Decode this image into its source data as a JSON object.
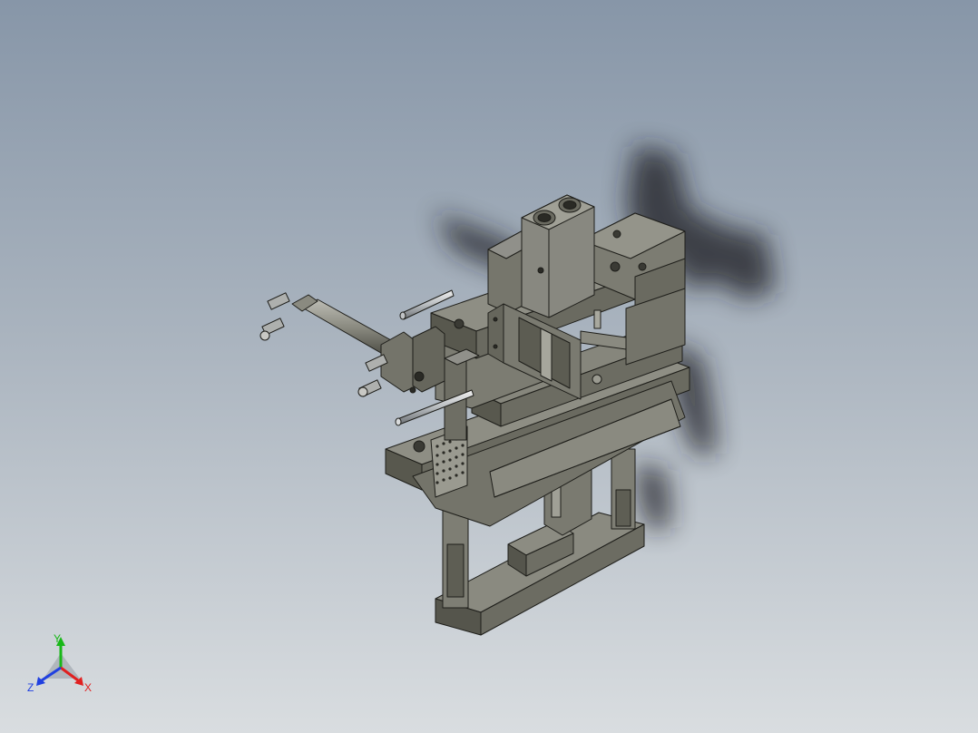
{
  "viewport": {
    "background_top": "#8796a8",
    "background_bottom": "#d9dde0"
  },
  "model": {
    "body_color": "#6f6f64",
    "edge_color": "#1e1e1a",
    "shadow_color": "#1c1f24",
    "rod_color": "#c9ccce"
  },
  "triad": {
    "x_label": "X",
    "y_label": "Y",
    "z_label": "Z",
    "x_color": "#e02020",
    "y_color": "#18b818",
    "z_color": "#2040e0"
  }
}
